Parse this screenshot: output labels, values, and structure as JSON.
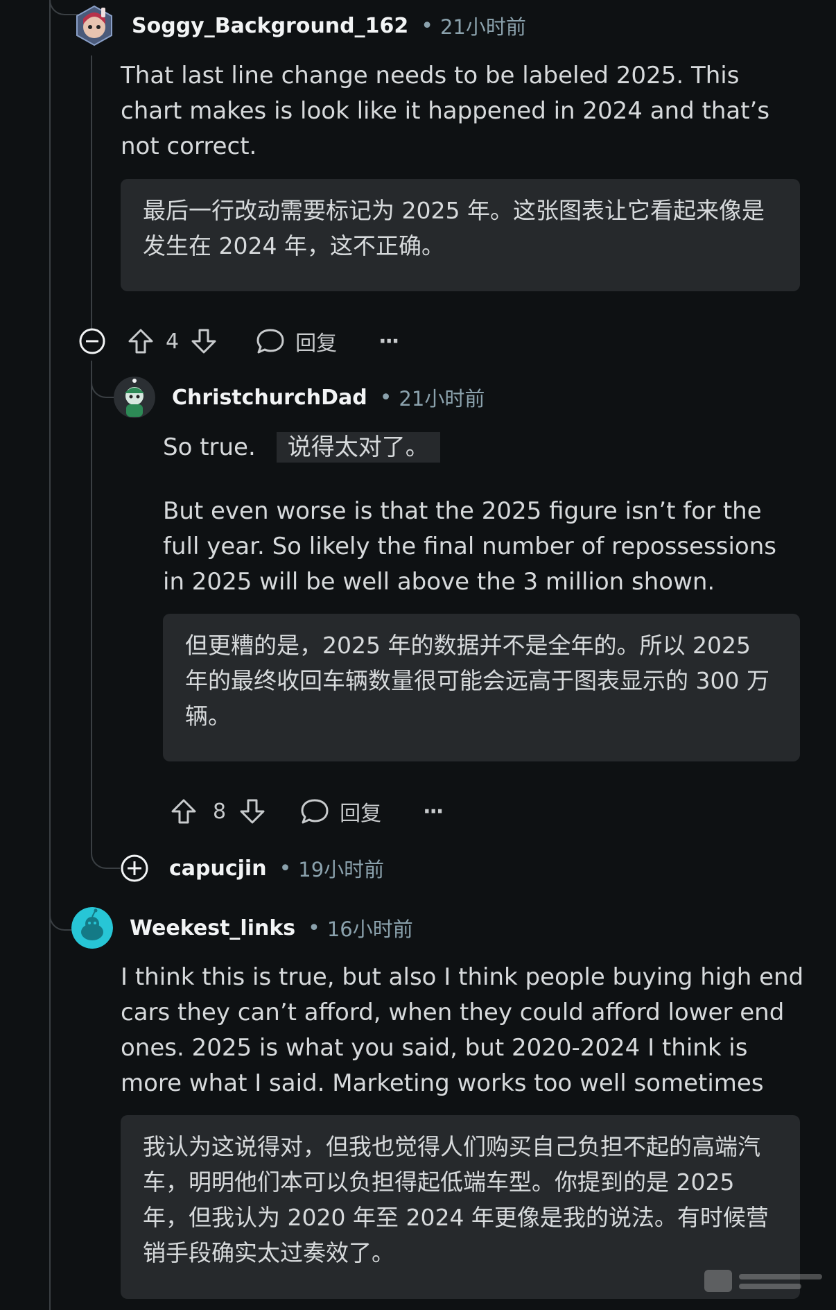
{
  "comments": [
    {
      "username": "Soggy_Background_162",
      "separator": "•",
      "time": "21小时前",
      "text": "That last line change needs to be labeled 2025. This chart makes is look like it happened in 2024 and that’s not correct.",
      "translation": "最后一行改动需要标记为 2025 年。这张图表让它看起来像是发生在 2024 年，这不正确。",
      "votes": "4",
      "reply_label": "回复",
      "more": "···"
    },
    {
      "username": "ChristchurchDad",
      "separator": "•",
      "time": "21小时前",
      "intro_text": "So true.",
      "intro_translation": "说得太对了。",
      "text": "But even worse is that the 2025 figure isn’t for the full year. So likely the final number of repossessions in 2025 will be well above the 3 million shown.",
      "translation": "但更糟的是，2025 年的数据并不是全年的。所以 2025 年的最终收回车辆数量很可能会远高于图表显示的 300 万辆。",
      "votes": "8",
      "reply_label": "回复",
      "more": "···"
    },
    {
      "username": "capucjin",
      "separator": "•",
      "time": "19小时前"
    },
    {
      "username": "Weekest_links",
      "separator": "•",
      "time": "16小时前",
      "text": "I think this is true, but also I think people buying high end cars they can’t afford, when they could afford lower end ones. 2025 is what you said, but 2020-2024 I think is more what I said. Marketing works too well sometimes",
      "translation": "我认为这说得对，但我也觉得人们购买自己负担不起的高端汽车，明明他们本可以负担得起低端车型。你提到的是 2025 年，但我认为 2020 年至 2024 年更像是我的说法。有时候营销手段确实太过奏效了。"
    }
  ],
  "colors": {
    "background": "#0e1113",
    "box": "#26292c",
    "meta": "#8ba2ad",
    "line": "#3a3f43"
  }
}
